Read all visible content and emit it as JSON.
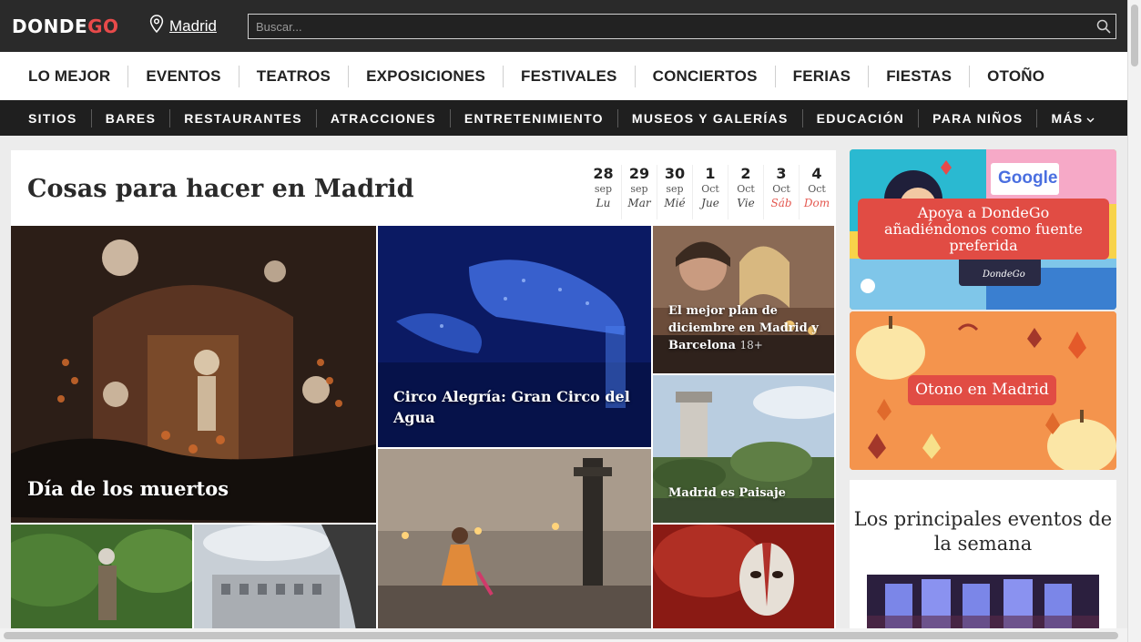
{
  "header": {
    "logo_left": "DONDE",
    "logo_right": "GO",
    "location": "Madrid",
    "search_placeholder": "Buscar..."
  },
  "nav_primary": [
    "LO MEJOR",
    "EVENTOS",
    "TEATROS",
    "EXPOSICIONES",
    "FESTIVALES",
    "CONCIERTOS",
    "FERIAS",
    "FIESTAS",
    "OTOÑO"
  ],
  "nav_secondary": [
    "SITIOS",
    "BARES",
    "RESTAURANTES",
    "ATRACCIONES",
    "ENTRETENIMIENTO",
    "MUSEOS Y GALERÍAS",
    "EDUCACIÓN",
    "PARA NIÑOS",
    "MÁS"
  ],
  "main": {
    "title": "Cosas para hacer en Madrid",
    "dates": [
      {
        "num": "28",
        "month": "sep",
        "day": "Lu"
      },
      {
        "num": "29",
        "month": "sep",
        "day": "Mar"
      },
      {
        "num": "30",
        "month": "sep",
        "day": "Mié"
      },
      {
        "num": "1",
        "month": "Oct",
        "day": "Jue"
      },
      {
        "num": "2",
        "month": "Oct",
        "day": "Vie"
      },
      {
        "num": "3",
        "month": "Oct",
        "day": "Sáb"
      },
      {
        "num": "4",
        "month": "Oct",
        "day": "Dom"
      }
    ],
    "tiles": {
      "muertos": "Día de los muertos",
      "circo": "Circo Alegría: Gran Circo del Agua",
      "plan": "El mejor plan de diciembre en Madrid y Barcelona",
      "plan_badge": "18+",
      "paisaje": "Madrid es Paisaje"
    }
  },
  "sidebar": {
    "ad1_text": "Apoya a DondeGo añadiéndonos como fuente preferida",
    "ad1_google": "Google",
    "ad1_brand": "DondeGo",
    "ad2_text": "Otono en Madrid",
    "events_title": "Los principales eventos de la semana"
  },
  "colors": {
    "accent": "#e14c44",
    "header_bg": "#2a2a2a",
    "nav2_bg": "#1f1f1f",
    "autumn_bg": "#f4944d",
    "weekend": "#e4574f"
  }
}
